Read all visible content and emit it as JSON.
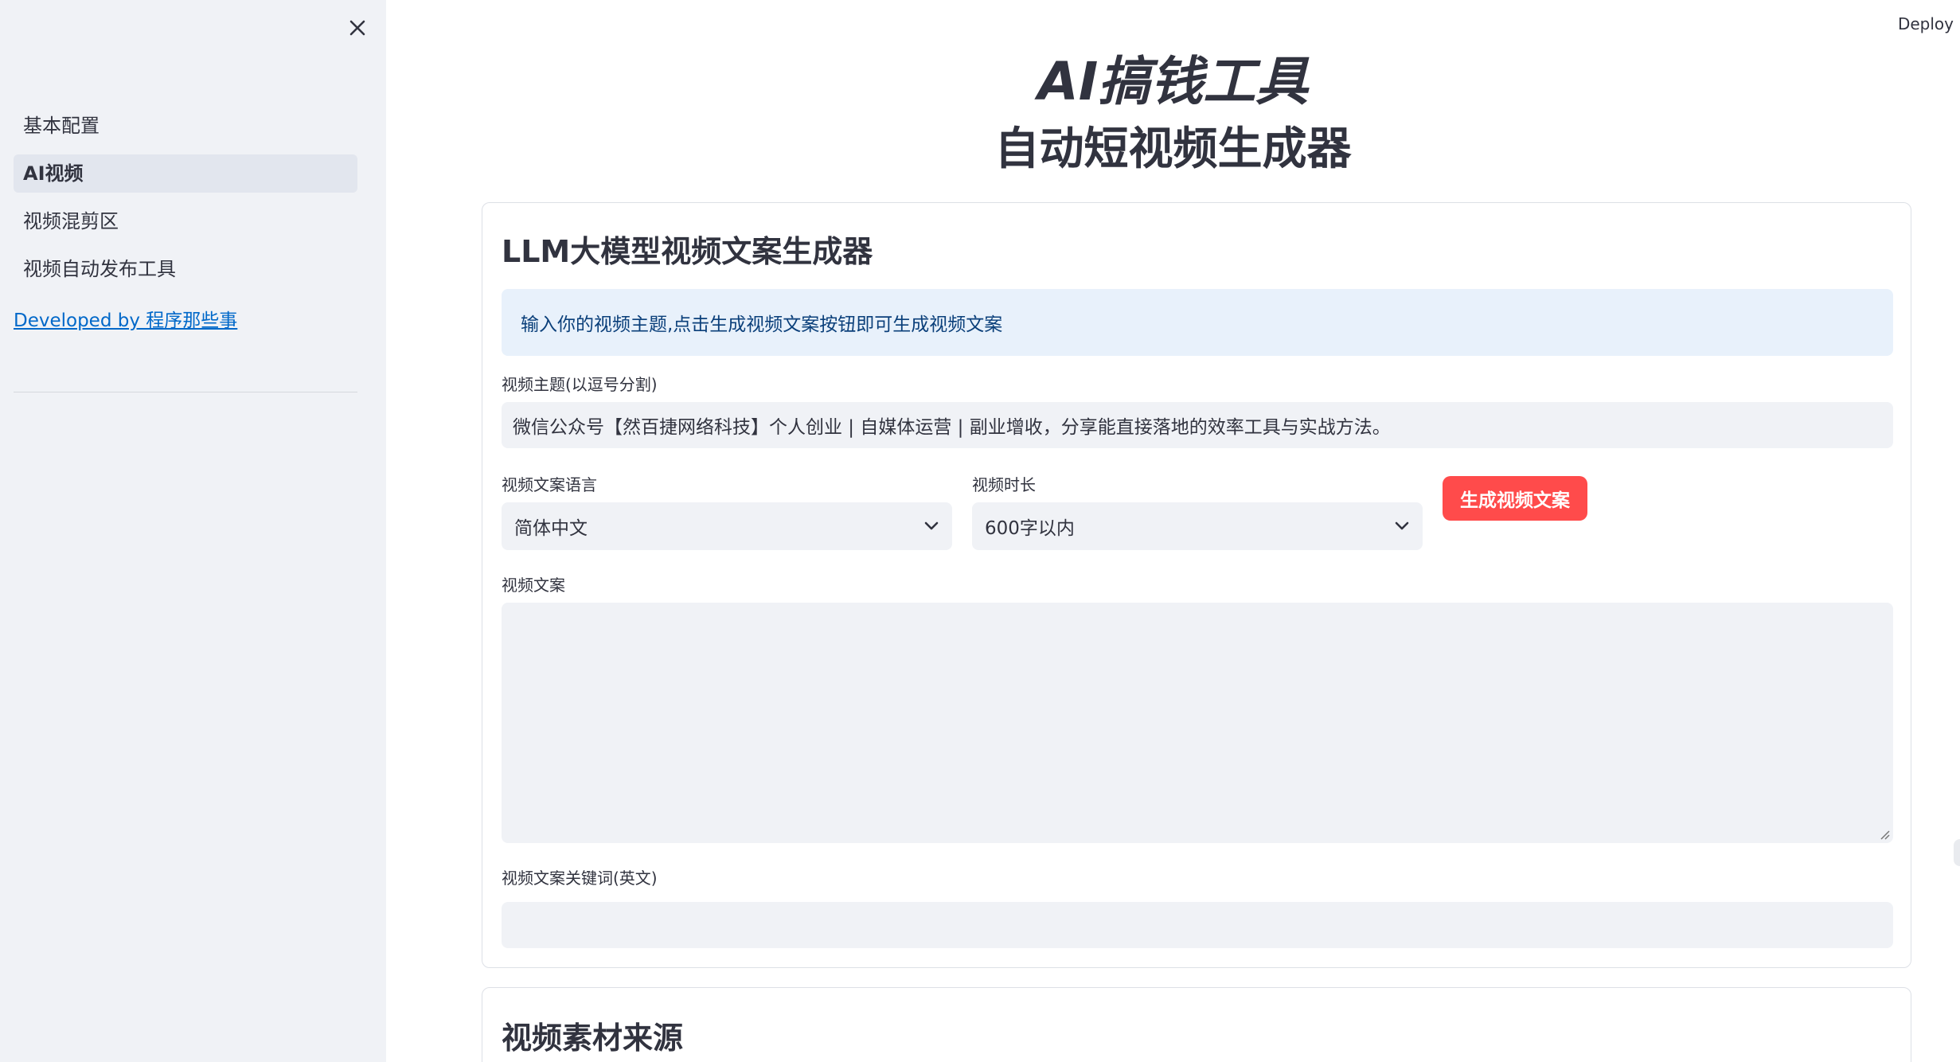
{
  "sidebar": {
    "items": [
      {
        "label": "基本配置",
        "active": false
      },
      {
        "label": "AI视频",
        "active": true
      },
      {
        "label": "视频混剪区",
        "active": false
      },
      {
        "label": "视频自动发布工具",
        "active": false
      }
    ],
    "dev_link": "Developed by 程序那些事"
  },
  "header": {
    "deploy_label": "Deploy",
    "title": "AI搞钱工具",
    "subtitle": "自动短视频生成器"
  },
  "card1": {
    "title": "LLM大模型视频文案生成器",
    "info": "输入你的视频主题,点击生成视频文案按钮即可生成视频文案",
    "topic_label": "视频主题(以逗号分割)",
    "topic_value": "微信公众号【然百捷网络科技】个人创业 | 自媒体运营 | 副业增收，分享能直接落地的效率工具与实战方法。",
    "language_label": "视频文案语言",
    "language_value": "简体中文",
    "duration_label": "视频时长",
    "duration_value": "600字以内",
    "generate_button": "生成视频文案",
    "script_label": "视频文案",
    "script_value": "",
    "keywords_label": "视频文案关键词(英文)",
    "keywords_value": ""
  },
  "card2": {
    "title": "视频素材来源"
  },
  "colors": {
    "primary": "#ff4b4b",
    "sidebar_bg": "#f0f2f6",
    "info_bg": "#e8f1fb",
    "link": "#0068c9"
  }
}
